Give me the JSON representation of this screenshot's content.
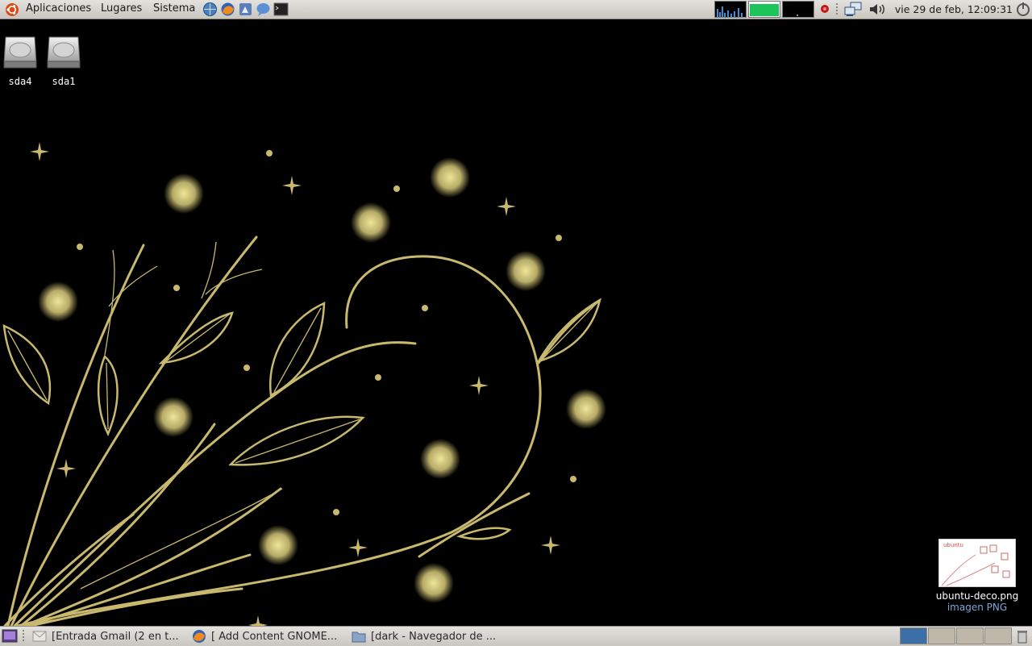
{
  "top_panel": {
    "menus": [
      {
        "label": "Aplicaciones",
        "icon": "ubuntu-logo-icon"
      },
      {
        "label": "Lugares"
      },
      {
        "label": "Sistema"
      }
    ],
    "launchers": [
      "network-globe-icon",
      "firefox-icon",
      "image-editor-icon",
      "chat-icon",
      "terminal-icon"
    ],
    "tray": [
      "system-monitor-icon",
      "battery-icon",
      "cpu-graph-icon",
      "alert-icon",
      "network-icon",
      "volume-icon",
      "power-icon"
    ],
    "clock": "vie 29 de feb, 12:09:31"
  },
  "desktop": {
    "drives": [
      {
        "label": "sda4",
        "icon": "harddrive-icon"
      },
      {
        "label": "sda1",
        "icon": "harddrive-icon"
      }
    ],
    "file": {
      "name": "ubuntu-deco.png",
      "type": "imagen PNG",
      "icon": "image-thumbnail-icon"
    },
    "wallpaper_colors": {
      "background": "#000000",
      "accent": "#c8b96f"
    }
  },
  "bottom_panel": {
    "tasks": [
      {
        "label": "[Entrada Gmail (2 en t...",
        "icon": "mail-icon"
      },
      {
        "label": "[ Add Content GNOME...",
        "icon": "firefox-icon"
      },
      {
        "label": "[dark - Navegador de ...",
        "icon": "folder-icon"
      }
    ],
    "workspaces": 4,
    "active_workspace": 1
  }
}
